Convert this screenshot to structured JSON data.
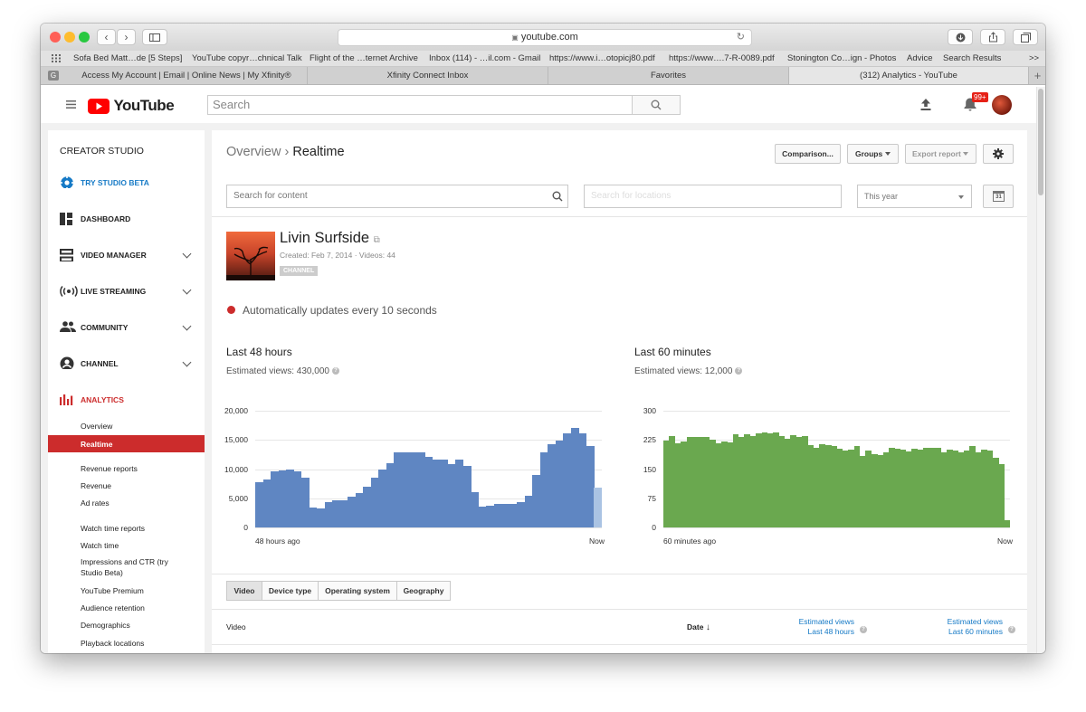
{
  "browser": {
    "url": "youtube.com",
    "favorites": [
      "Sofa Bed Matt…de [5 Steps]",
      "YouTube copyr…chnical Talk",
      "Flight of the …ternet Archive",
      "Inbox (114) - …il.com - Gmail",
      "https://www.i…otopicj80.pdf",
      "https://www….7-R-0089.pdf",
      "Stonington Co…ign - Photos",
      "Advice",
      "Search Results"
    ],
    "tabs": [
      "Access My Account | Email | Online News | My Xfinity®",
      "Xfinity Connect Inbox",
      "Favorites",
      "(312) Analytics - YouTube"
    ],
    "g_badge": "G",
    "overflow": ">>"
  },
  "header": {
    "logo_text": "YouTube",
    "search_placeholder": "Search",
    "notif_badge": "99+"
  },
  "sidebar": {
    "title": "CREATOR STUDIO",
    "beta": "TRY STUDIO BETA",
    "dashboard": "DASHBOARD",
    "video_manager": "VIDEO MANAGER",
    "live": "LIVE STREAMING",
    "community": "COMMUNITY",
    "channel": "CHANNEL",
    "analytics": "ANALYTICS",
    "sub": [
      "Overview",
      "Realtime",
      "Revenue reports",
      "Revenue",
      "Ad rates",
      "Watch time reports",
      "Watch time",
      "Impressions and CTR (try",
      "Studio Beta)",
      "YouTube Premium",
      "Audience retention",
      "Demographics",
      "Playback locations"
    ]
  },
  "main": {
    "breadcrumb_parent": "Overview",
    "breadcrumb_sep": "›",
    "breadcrumb_current": "Realtime",
    "btn_comparison": "Comparison...",
    "btn_groups": "Groups",
    "btn_export": "Export report",
    "search_content": "Search for content",
    "search_locations": "Search for locations",
    "period": "This year",
    "calendar_day": "31",
    "channel_name": "Livin Surfside",
    "channel_meta": "Created: Feb 7, 2014  ·  Videos: 44",
    "channel_tag": "CHANNEL",
    "auto_update": "Automatically updates every 10 seconds",
    "left_title": "Last 48 hours",
    "left_sub": "Estimated views: 430,000",
    "right_title": "Last 60 minutes",
    "right_sub": "Estimated views: 12,000",
    "tabs": [
      "Video",
      "Device type",
      "Operating system",
      "Geography"
    ],
    "col_video": "Video",
    "col_date": "Date",
    "col_48_a": "Estimated views",
    "col_48_b": "Last 48 hours",
    "col_60_a": "Estimated views",
    "col_60_b": "Last 60 minutes"
  },
  "colors": {
    "blue": "#5f86c2",
    "blue_light": "#aac3e3",
    "green": "#6aa84f",
    "red": "#cc2c2c",
    "link": "#167ac6"
  },
  "chart_data": [
    {
      "type": "bar",
      "title": "Last 48 hours",
      "xlabel_start": "48 hours ago",
      "xlabel_end": "Now",
      "yticks": [
        "0",
        "5,000",
        "10,000",
        "15,000",
        "20,000"
      ],
      "ylim": [
        0,
        20000
      ],
      "values": [
        7800,
        8200,
        9600,
        9800,
        10000,
        9600,
        8600,
        3400,
        3300,
        4400,
        4600,
        4700,
        5300,
        5900,
        7000,
        8500,
        9900,
        11000,
        12900,
        12900,
        12900,
        12900,
        12100,
        11700,
        11700,
        10900,
        11700,
        10500,
        6100,
        3600,
        3700,
        4000,
        4100,
        4000,
        4400,
        5500,
        9000,
        12800,
        14300,
        14900,
        16100,
        17000,
        16100,
        13900,
        6800
      ]
    },
    {
      "type": "bar",
      "title": "Last 60 minutes",
      "xlabel_start": "60 minutes ago",
      "xlabel_end": "Now",
      "yticks": [
        "0",
        "75",
        "150",
        "225",
        "300"
      ],
      "ylim": [
        0,
        300
      ],
      "values": [
        223,
        236,
        217,
        220,
        233,
        233,
        233,
        233,
        225,
        216,
        220,
        219,
        240,
        232,
        240,
        236,
        241,
        245,
        242,
        245,
        235,
        228,
        238,
        233,
        234,
        212,
        205,
        215,
        212,
        210,
        203,
        198,
        200,
        210,
        184,
        198,
        188,
        187,
        194,
        204,
        203,
        200,
        195,
        203,
        200,
        205,
        205,
        205,
        192,
        200,
        198,
        192,
        198,
        209,
        192,
        200,
        198,
        178,
        162,
        18
      ]
    }
  ]
}
